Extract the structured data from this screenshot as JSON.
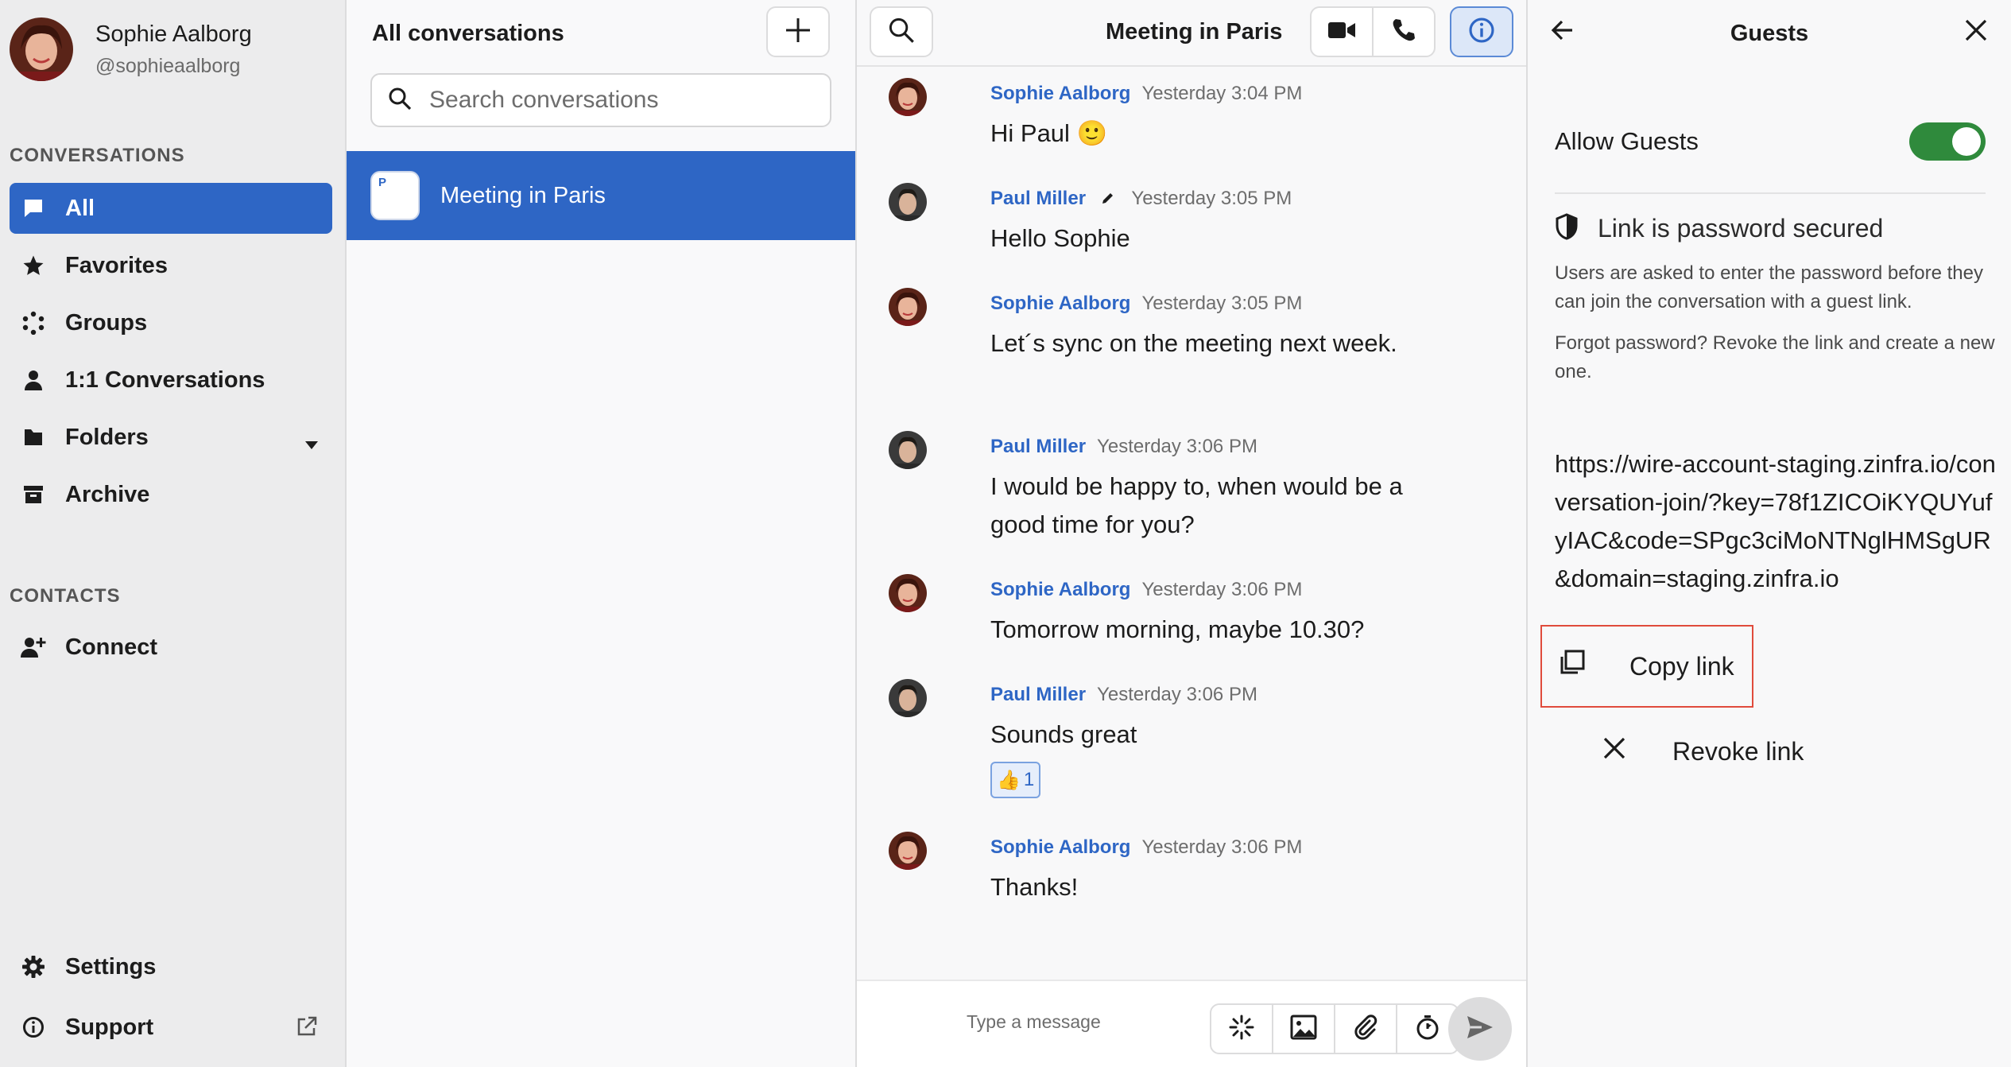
{
  "user": {
    "name": "Sophie Aalborg",
    "handle": "@sophieaalborg"
  },
  "sidebar": {
    "conversations_label": "CONVERSATIONS",
    "items": [
      {
        "label": "All",
        "icon": "speech-bubble-icon",
        "active": true
      },
      {
        "label": "Favorites",
        "icon": "star-icon"
      },
      {
        "label": "Groups",
        "icon": "groups-icon"
      },
      {
        "label": "1:1 Conversations",
        "icon": "person-icon"
      },
      {
        "label": "Folders",
        "icon": "folder-icon"
      },
      {
        "label": "Archive",
        "icon": "archive-icon"
      }
    ],
    "contacts_label": "CONTACTS",
    "connect_label": "Connect",
    "settings_label": "Settings",
    "support_label": "Support"
  },
  "conversation_list": {
    "title": "All conversations",
    "search_placeholder": "Search conversations",
    "items": [
      {
        "name": "Meeting in Paris",
        "avatar_letter": "P",
        "selected": true
      }
    ]
  },
  "chat": {
    "title": "Meeting in Paris",
    "messages": [
      {
        "author": "Sophie Aalborg",
        "time": "Yesterday 3:04 PM",
        "text": "Hi Paul 🙂"
      },
      {
        "author": "Paul Miller",
        "time": "Yesterday 3:05 PM",
        "text": "Hello Sophie",
        "edited": true
      },
      {
        "author": "Sophie Aalborg",
        "time": "Yesterday 3:05 PM",
        "text": "Let´s sync on the meeting next week."
      },
      {
        "author": "Paul Miller",
        "time": "Yesterday 3:06 PM",
        "text": "I would be happy to, when would be a good time for you?"
      },
      {
        "author": "Sophie Aalborg",
        "time": "Yesterday 3:06 PM",
        "text": "Tomorrow morning, maybe 10.30?"
      },
      {
        "author": "Paul Miller",
        "time": "Yesterday 3:06 PM",
        "text": "Sounds great",
        "reaction": {
          "emoji": "👍",
          "count": "1"
        }
      },
      {
        "author": "Sophie Aalborg",
        "time": "Yesterday 3:06 PM",
        "text": "Thanks!"
      }
    ],
    "composer_placeholder": "Type a message"
  },
  "guests_panel": {
    "title": "Guests",
    "allow_guests_label": "Allow Guests",
    "allow_guests_on": true,
    "password_title": "Link is password secured",
    "password_note": "Users are asked to enter the password before they can join the conversation with a guest link.",
    "forgot_note": "Forgot password? Revoke the link and create a new one.",
    "link": "https://wire-account-staging.zinfra.io/conversation-join/?key=78f1ZICOiKYQUYufyIAC&code=SPgc3ciMoNTNglHMSgUR&domain=staging.zinfra.io",
    "copy_label": "Copy link",
    "revoke_label": "Revoke link"
  },
  "colors": {
    "accent": "#2e66c5",
    "toggle_on": "#2f8a3c",
    "highlight_border": "#e04b3c"
  }
}
